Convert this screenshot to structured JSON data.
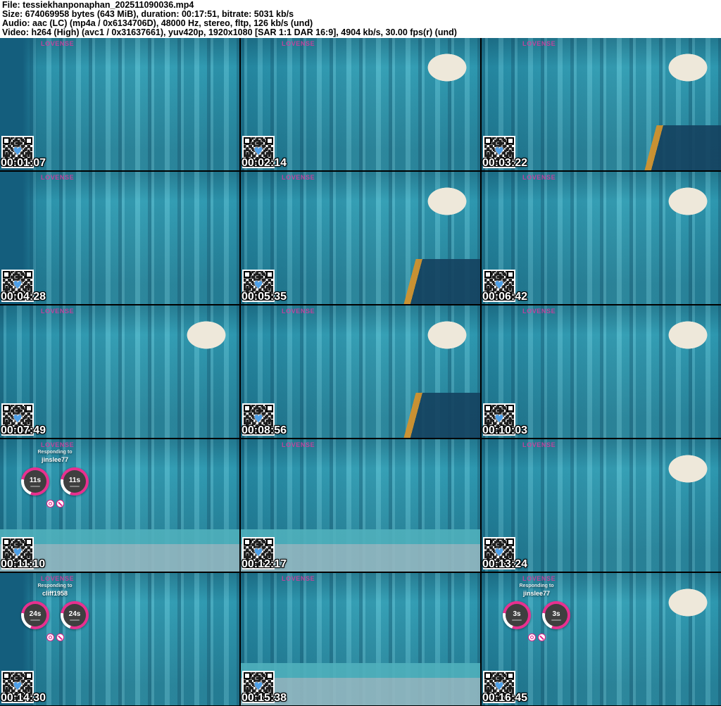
{
  "header": {
    "lines": [
      "File: tessiekhanponaphan_202511090036.mp4",
      "Size: 674069958 bytes (643 MiB), duration: 00:17:51, bitrate: 5031 kb/s",
      "Audio: aac (LC) (mp4a / 0x6134706D), 48000 Hz, stereo, fltp, 126 kb/s (und)",
      "Video: h264 (High) (avc1 / 0x31637661), yuv420p, 1920x1080 [SAR 1:1 DAR 16:9], 4904 kb/s, 30.00 fps(r) (und)"
    ]
  },
  "watermark": "LOVENSE",
  "icons": {
    "heart_glyph": "♥"
  },
  "grid": {
    "columns": 3,
    "rows": 5,
    "cells": [
      {
        "time": "00:01:07",
        "variant": "v0"
      },
      {
        "time": "00:02:14",
        "variant": "v1"
      },
      {
        "time": "00:03:22",
        "variant": "v2"
      },
      {
        "time": "00:04:28",
        "variant": "v0"
      },
      {
        "time": "00:05:35",
        "variant": "v2"
      },
      {
        "time": "00:06:42",
        "variant": "v1"
      },
      {
        "time": "00:07:49",
        "variant": "v1"
      },
      {
        "time": "00:08:56",
        "variant": "v2"
      },
      {
        "time": "00:10:03",
        "variant": "v1"
      },
      {
        "time": "00:11:10",
        "variant": "v3",
        "overlay": {
          "responding_label": "Responding to",
          "username": "jinslee77",
          "timers": [
            "11s",
            "11s"
          ]
        }
      },
      {
        "time": "00:12:17",
        "variant": "v3"
      },
      {
        "time": "00:13:24",
        "variant": "v1"
      },
      {
        "time": "00:14:30",
        "variant": "v0",
        "overlay": {
          "responding_label": "Responding to",
          "username": "cliff1958",
          "timers": [
            "24s",
            "24s"
          ]
        }
      },
      {
        "time": "00:15:38",
        "variant": "v3"
      },
      {
        "time": "00:16:45",
        "variant": "v1",
        "overlay": {
          "responding_label": "Responding to",
          "username": "jinslee77",
          "timers": [
            "3s",
            "3s"
          ]
        }
      }
    ]
  },
  "colors": {
    "header_bg": "#ffffff",
    "header_text": "#000000",
    "background": "#000000",
    "curtain_teal": "#2f9db5",
    "curtain_light": "#5ec2d3",
    "curtain_dark": "#1d7493",
    "lamp_white": "#ece7db",
    "floor": "#93b7c0",
    "watermark_pink": "#ce3e9e",
    "timer_ring_pink": "#e8308f",
    "timer_face": "#3f3f3f",
    "timestamp_text": "#ffffff",
    "heart_blue": "#4d9fe8"
  }
}
